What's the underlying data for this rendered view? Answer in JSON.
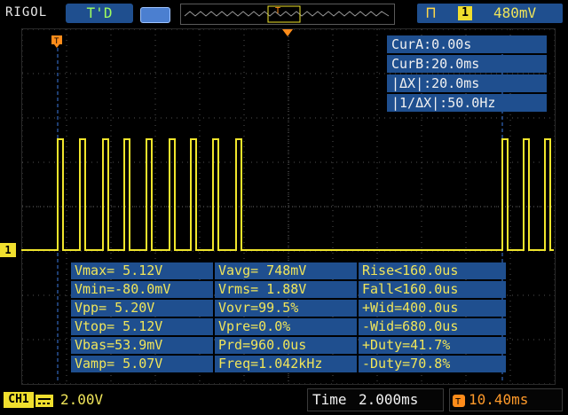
{
  "brand": "RIGOL",
  "trigger_status": "T'D",
  "trigger": {
    "edge_icon": "rising-edge-icon",
    "channel": "1",
    "level": "480mV"
  },
  "cursors": {
    "cur_a": "CurA:0.00s",
    "cur_b": "CurB:20.0ms",
    "delta_x": "|ΔX|:20.0ms",
    "inv_delta_x": "|1/ΔX|:50.0Hz"
  },
  "measurements": [
    [
      "Vmax= 5.12V",
      "Vavg= 748mV",
      "Rise<160.0us"
    ],
    [
      "Vmin=-80.0mV",
      "Vrms= 1.88V",
      "Fall<160.0us"
    ],
    [
      "Vpp= 5.20V",
      "Vovr=99.5%",
      "+Wid=400.0us"
    ],
    [
      "Vtop= 5.12V",
      "Vpre=0.0%",
      "-Wid=680.0us"
    ],
    [
      "Vbas=53.9mV",
      "Prd=960.0us",
      "+Duty=41.7%"
    ],
    [
      "Vamp= 5.07V",
      "Freq=1.042kHz",
      "-Duty=70.8%"
    ]
  ],
  "channel1": {
    "label": "CH1",
    "scale": "2.00V"
  },
  "timebase": {
    "label": "Time",
    "value": "2.000ms"
  },
  "trigger_offset": {
    "value": "10.40ms"
  },
  "markers": {
    "ch1_marker": "1",
    "trigger_marker": "T"
  },
  "colors": {
    "trace": "#f0e52c",
    "panel": "#1f4f8f",
    "cursor": "#3d7ae0",
    "trigger_marker": "#ff8c1a"
  }
}
